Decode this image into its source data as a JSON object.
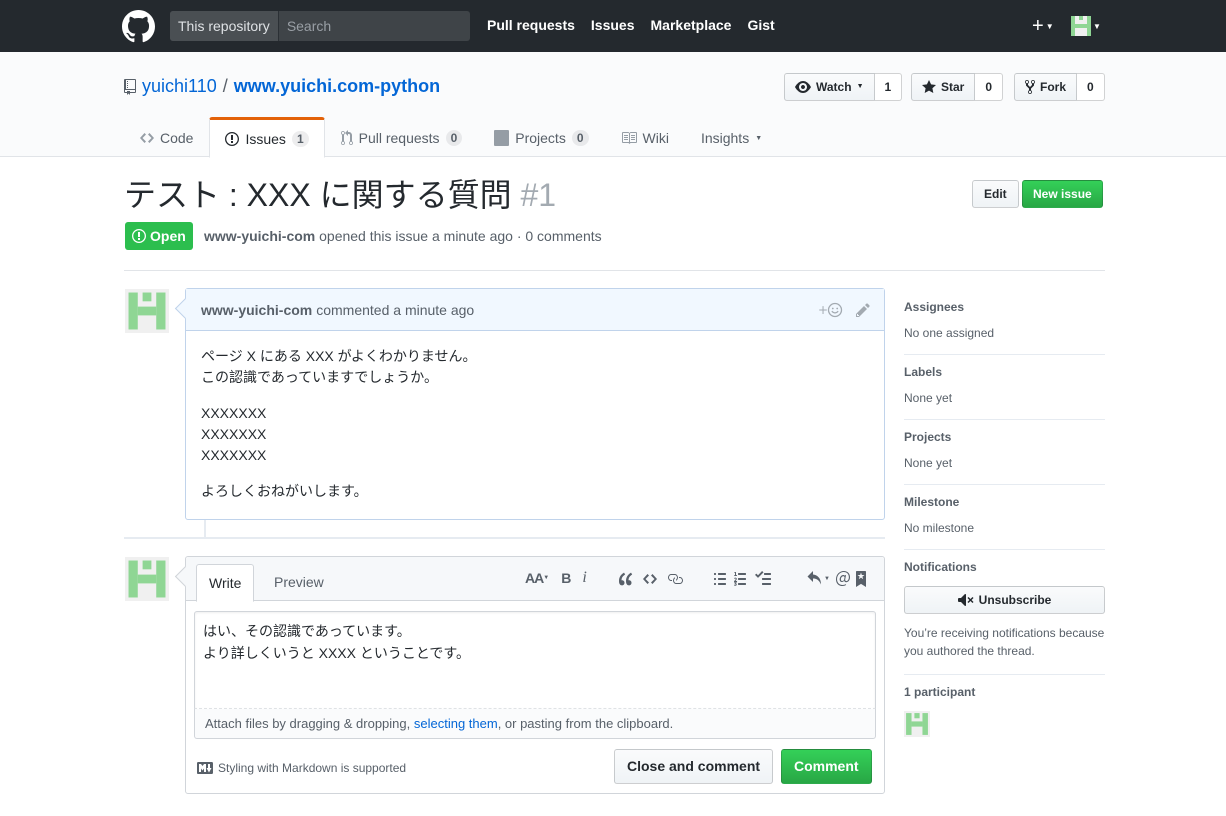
{
  "header": {
    "search_scope": "This repository",
    "search_placeholder": "Search",
    "nav": [
      "Pull requests",
      "Issues",
      "Marketplace",
      "Gist"
    ],
    "plus_label": "+"
  },
  "repo": {
    "owner": "yuichi110",
    "separator": "/",
    "name": "www.yuichi.com-python",
    "watch_label": "Watch",
    "watch_count": "1",
    "star_label": "Star",
    "star_count": "0",
    "fork_label": "Fork",
    "fork_count": "0",
    "tabs": [
      {
        "label": "Code",
        "count": null
      },
      {
        "label": "Issues",
        "count": "1"
      },
      {
        "label": "Pull requests",
        "count": "0"
      },
      {
        "label": "Projects",
        "count": "0"
      },
      {
        "label": "Wiki",
        "count": null
      },
      {
        "label": "Insights",
        "count": null
      }
    ]
  },
  "issue": {
    "title": "テスト : XXX に関する質問",
    "number": "#1",
    "edit_label": "Edit",
    "new_issue_label": "New issue",
    "state": "Open",
    "author": "www-yuichi-com",
    "meta": "opened this issue a minute ago · 0 comments"
  },
  "comment": {
    "author": "www-yuichi-com",
    "time": "commented a minute ago",
    "body": [
      "ページ X にある XXX がよくわかりません。\nこの認識であっていますでしょうか。",
      "XXXXXXX\nXXXXXXX\nXXXXXXX",
      "よろしくおねがいします。"
    ]
  },
  "form": {
    "write_tab": "Write",
    "preview_tab": "Preview",
    "text": "はい、その認識であっています。\nより詳しくいうと XXXX ということです。",
    "attach_prefix": "Attach files by dragging & dropping, ",
    "attach_link": "selecting them",
    "attach_suffix": ", or pasting from the clipboard.",
    "markdown_note": "Styling with Markdown is supported",
    "close_label": "Close and comment",
    "comment_label": "Comment",
    "toolbar": {
      "heading": "AA",
      "bold": "B",
      "italic": "i"
    }
  },
  "sidebar": {
    "assignees_head": "Assignees",
    "assignees_val": "No one assigned",
    "labels_head": "Labels",
    "labels_val": "None yet",
    "projects_head": "Projects",
    "projects_val": "None yet",
    "milestone_head": "Milestone",
    "milestone_val": "No milestone",
    "notifications_head": "Notifications",
    "unsubscribe_label": "Unsubscribe",
    "notif_text": "You’re receiving notifications because you authored the thread.",
    "participants_head": "1 participant"
  },
  "colors": {
    "header_bg": "#24292e",
    "link": "#0366d6",
    "open_green": "#2cbe4e",
    "tab_accent": "#e36209"
  }
}
